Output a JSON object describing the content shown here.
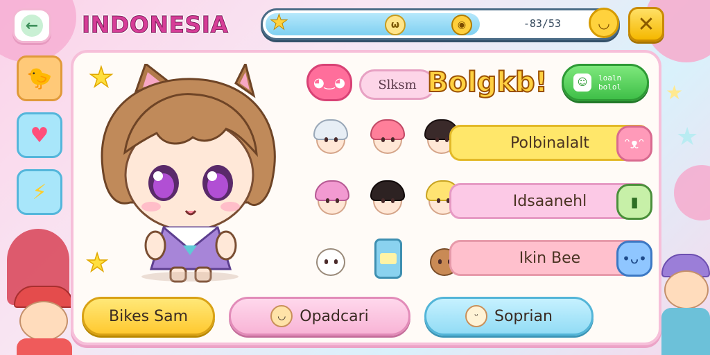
{
  "header": {
    "back_icon": "arrow-left-icon",
    "country": "INDONESIA",
    "progress": {
      "fill_fraction": 0.62,
      "text": "-83/53"
    },
    "close_icon": "close-x-icon"
  },
  "sidebar": {
    "items": [
      {
        "icon": "chick-icon",
        "glyph": "🐤"
      },
      {
        "icon": "heart-icon",
        "glyph": "♥"
      },
      {
        "icon": "lightning-icon",
        "glyph": "⚡"
      }
    ]
  },
  "panel": {
    "tag": "Slksm",
    "title": "Bolgkb!",
    "green_button": {
      "icon": "chat-icon",
      "line1": "loaln",
      "line2": "bolol"
    },
    "stats": [
      {
        "label": "Polbinalalt",
        "icon": "pink-blob-icon"
      },
      {
        "label": "Idsaanehl",
        "icon": "green-gem-icon"
      },
      {
        "label": "Ikin Bee",
        "icon": "blue-blob-icon"
      }
    ],
    "bottom_buttons": [
      {
        "label": "Bikes Sam"
      },
      {
        "label": "Opadcari"
      },
      {
        "label": "Soprian"
      }
    ]
  },
  "colors": {
    "accent_pink": "#d63d97",
    "panel_border": "#f6bfd9",
    "gold": "#ffd142",
    "green": "#3fbf48"
  }
}
